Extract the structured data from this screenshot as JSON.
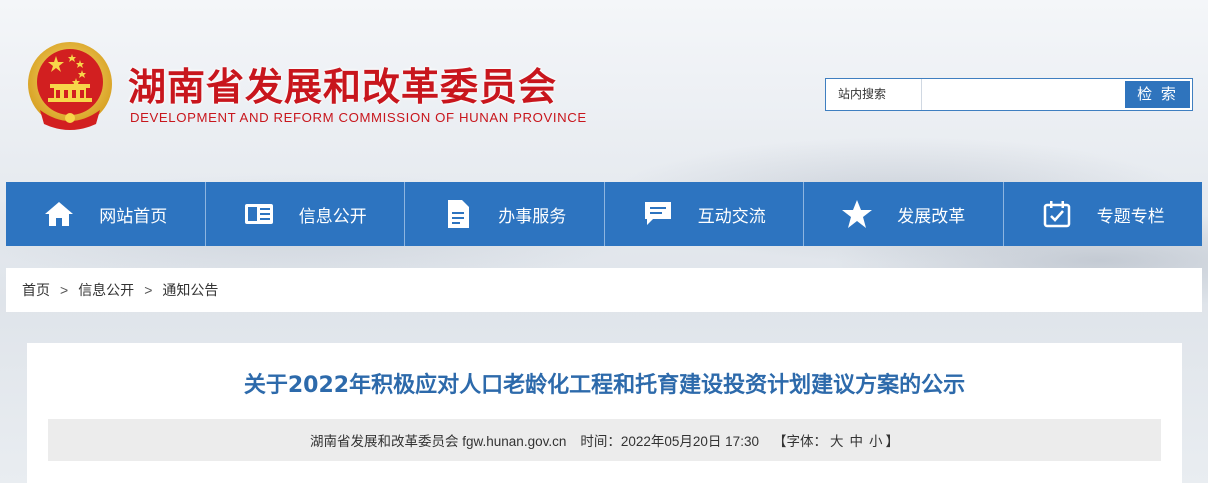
{
  "header": {
    "title": "湖南省发展和改革委员会",
    "subtitle": "DEVELOPMENT AND REFORM COMMISSION OF HUNAN PROVINCE",
    "brand_color": "#c8161d"
  },
  "search": {
    "label": "站内搜索",
    "value": "",
    "placeholder": "",
    "button": "检 索"
  },
  "nav": {
    "color": "#2d74c0",
    "items": [
      {
        "label": "网站首页",
        "icon": "home-icon"
      },
      {
        "label": "信息公开",
        "icon": "info-card-icon"
      },
      {
        "label": "办事服务",
        "icon": "document-icon"
      },
      {
        "label": "互动交流",
        "icon": "chat-icon"
      },
      {
        "label": "发展改革",
        "icon": "star-icon"
      },
      {
        "label": "专题专栏",
        "icon": "calendar-check-icon"
      }
    ]
  },
  "breadcrumb": {
    "items": [
      "首页",
      "信息公开",
      "通知公告"
    ],
    "separator": ">"
  },
  "article": {
    "title": "关于2022年积极应对人口老龄化工程和托育建设投资计划建议方案的公示",
    "source": "湖南省发展和改革委员会 fgw.hunan.gov.cn",
    "time_label": "时间：",
    "time": "2022年05月20日 17:30",
    "font_label_open": "【字体：",
    "font_large": "大",
    "font_medium": "中",
    "font_small": "小",
    "font_label_close": "】",
    "title_color": "#2d6aab"
  }
}
